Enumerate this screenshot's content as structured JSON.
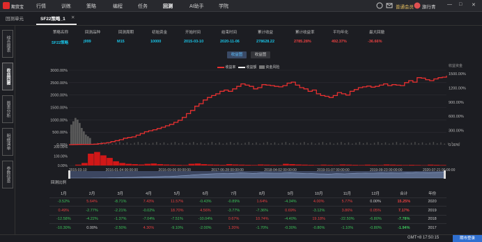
{
  "topnav": {
    "logo_text": "期货宝",
    "items": [
      "行情",
      "训练",
      "策略",
      "编程",
      "任务",
      "回测",
      "AI助手",
      "学院"
    ],
    "active_index": 5,
    "user_badge": "普通会员",
    "user_name": "旗行青",
    "window_controls": [
      "—",
      "□",
      "✕"
    ]
  },
  "tabs": {
    "items": [
      "回测单元",
      "SF22策略_1"
    ],
    "active_index": 1,
    "close": "✕"
  },
  "leftnav": {
    "items": [
      "综合报表",
      "收益回撤",
      "图表分析",
      "明细清单",
      "参数信息"
    ],
    "active_index": 1
  },
  "summary": {
    "headers": [
      "策略名称",
      "回测品种",
      "回测周期",
      "初始资金",
      "开始时间",
      "结束时间",
      "累计收益",
      "累计收益率",
      "平均年化",
      "最大回撤"
    ],
    "values": [
      "SF22策略",
      "j999",
      "M15",
      "10000",
      "2015-03-10",
      "2020-11-06",
      "278628.22",
      "2785.28%",
      "492.37%",
      "-36.66%"
    ],
    "value_colors": [
      "#19c3e6",
      "#19c3e6",
      "#19c3e6",
      "#19c3e6",
      "#19c3e6",
      "#19c3e6",
      "#19c3e6",
      "#e84040",
      "#e84040",
      "#e84040"
    ]
  },
  "toggles": {
    "items": [
      "收益图",
      "收益图"
    ],
    "active_index": 0
  },
  "legend": {
    "items": [
      "收益率",
      "收益额",
      "资金风险"
    ],
    "colors": [
      "#e83030",
      "#ffffff",
      "#777777"
    ],
    "right_axis_title": "收益资金"
  },
  "chart_data": {
    "type": "line",
    "x_range": [
      "2015-03-10",
      "2020-11-06"
    ],
    "y_left": {
      "ticks": [
        "3000.00%",
        "2500.00%",
        "2000.00%",
        "1500.00%",
        "1000.00%",
        "500.00%",
        "0.00%"
      ],
      "range": [
        0,
        3000
      ]
    },
    "y_right": {
      "ticks": [
        "1500.00%",
        "1200.00%",
        "900.00%",
        "600.00%",
        "300.00%",
        "0.00%"
      ],
      "range": [
        0,
        1500
      ]
    },
    "drawdown_axis": {
      "ticks": [
        "200.00%",
        "100.00%",
        "0.00%"
      ]
    },
    "x_ticks": [
      "2015-03-10",
      "2016-01-04 00:00:00",
      "2016-09-06 00:00:00",
      "2017-06-28 00:00:00",
      "2018-04-02 00:00:00",
      "2019-01-07 00:00:00",
      "2019-09-23 00:00:00",
      "2020-07-21 00:00:00"
    ],
    "series": [
      {
        "name": "收益率",
        "values": [
          0,
          5,
          8,
          10,
          12,
          15,
          20,
          40,
          60,
          80,
          120,
          160,
          200,
          260,
          290,
          310,
          380,
          450,
          520,
          560,
          600,
          650,
          700,
          760,
          820,
          900,
          980,
          1100,
          1250,
          1380,
          1550,
          1650,
          1800,
          1900,
          1980,
          2050,
          2150,
          2200,
          2150,
          2250,
          2350,
          2450,
          2400,
          2350,
          2250,
          2300,
          2420,
          2400,
          2380,
          2350,
          2330,
          2380,
          2480,
          2520,
          2400,
          2300,
          2250,
          2150,
          2200,
          2050,
          1980,
          1950,
          1900,
          1980,
          2100,
          2050,
          2000,
          2150,
          2220,
          2300,
          2330,
          2360,
          2320,
          2350,
          2400,
          2450,
          2380,
          2420,
          2400,
          2380,
          2500,
          2580,
          2520,
          2700,
          2680,
          2620,
          2580,
          2650,
          2700,
          2720,
          2785
        ]
      }
    ],
    "drawdown_values": [
      0,
      5,
      15,
      70,
      80,
      60,
      45,
      25,
      15,
      10,
      8,
      6,
      10,
      12,
      8,
      6,
      5,
      4,
      3,
      10,
      12,
      8,
      6,
      5,
      4,
      8,
      6,
      5,
      4,
      3,
      6,
      5,
      4,
      3,
      10,
      8,
      6,
      5,
      4,
      3,
      5,
      4,
      3,
      6,
      5,
      4,
      3,
      5,
      4,
      3,
      6,
      5,
      4,
      3,
      4,
      3,
      2,
      5,
      4,
      3
    ],
    "risk_bars": [
      12,
      14,
      16,
      15,
      13,
      10,
      8,
      6,
      5,
      4
    ]
  },
  "scrubber": {
    "label": "回测比例"
  },
  "monthly_table": {
    "headers": [
      "1月",
      "2月",
      "3月",
      "4月",
      "5月",
      "6月",
      "7月",
      "8月",
      "9月",
      "10月",
      "11月",
      "12月",
      "合计",
      "年份"
    ],
    "rows": [
      [
        "-3.52%",
        "5.64%",
        "-8.71%",
        "7.43%",
        "11.57%",
        "-0.43%",
        "-0.89%",
        "1.64%",
        "-4.34%",
        "4.00%",
        "5.77%",
        "0.00%",
        "15.25%",
        "2020"
      ],
      [
        "0.49%",
        "-2.77%",
        "-2.21%",
        "-0.02%",
        "18.70%",
        "4.56%",
        "-3.77%",
        "-7.36%",
        "0.69%",
        "-3.12%",
        "3.86%",
        "0.05%",
        "7.17%",
        "2019"
      ],
      [
        "-12.58%",
        "-4.22%",
        "-1.37%",
        "-7.04%",
        "-7.51%",
        "-10.04%",
        "0.67%",
        "10.74%",
        "-4.40%",
        "19.18%",
        "-22.50%",
        "-6.80%",
        "-7.78%",
        "2018"
      ],
      [
        "-10.30%",
        "0.00%",
        "-2.50%",
        "4.30%",
        "-9.10%",
        "-2.00%",
        "1.20%",
        "-1.70%",
        "-0.30%",
        "-0.80%",
        "-1.10%",
        "-0.80%",
        "-1.94%",
        "2017"
      ]
    ]
  },
  "status": {
    "time": "GMT+8 17:50:15",
    "button": "期市登录"
  }
}
